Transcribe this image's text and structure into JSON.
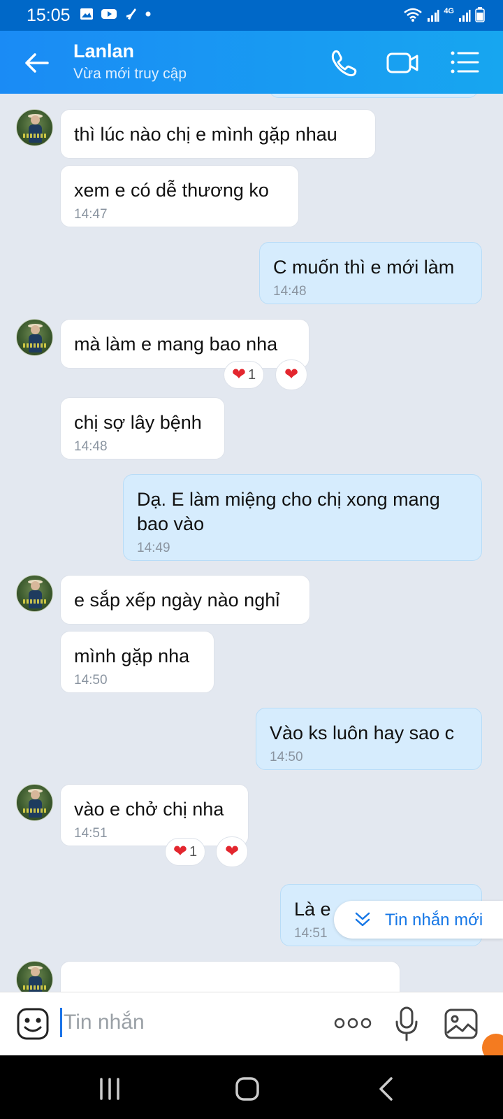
{
  "status_bar": {
    "time": "15:05",
    "network": "4G"
  },
  "header": {
    "contact_name": "Lanlan",
    "contact_status": "Vừa mới truy cập"
  },
  "messages": [
    {
      "text": "thì lúc nào chị e mình gặp nhau",
      "time": ""
    },
    {
      "text": "xem e có dễ thương ko",
      "time": "14:47"
    },
    {
      "text": "C muốn thì e mới làm",
      "time": "14:48"
    },
    {
      "text": "mà làm e mang bao nha",
      "time": "",
      "reaction_count": "1"
    },
    {
      "text": "chị sợ lây bệnh",
      "time": "14:48"
    },
    {
      "text": "Dạ. E làm miệng cho chị xong mang bao vào",
      "time": "14:49"
    },
    {
      "text": "e sắp xếp ngày nào nghỉ",
      "time": ""
    },
    {
      "text": "mình gặp nha",
      "time": "14:50"
    },
    {
      "text": "Vào ks luôn hay sao c",
      "time": "14:50"
    },
    {
      "text": "vào e chở chị nha",
      "time": "14:51",
      "reaction_count": "1"
    },
    {
      "text": "Là e",
      "time": "14:51"
    }
  ],
  "new_message_button": {
    "label": "Tin nhắn mới"
  },
  "composer": {
    "placeholder": "Tin nhắn"
  },
  "colors": {
    "header_start": "#1a8bf5",
    "header_end": "#17a6f0",
    "outgoing_bubble": "#d6ecfd",
    "incoming_bubble": "#ffffff",
    "chat_background": "#e3e8f0",
    "accent": "#1677e6",
    "heart": "#e3262e"
  }
}
